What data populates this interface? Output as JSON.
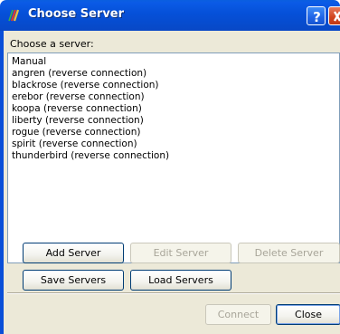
{
  "window": {
    "title": "Choose Server"
  },
  "dialog": {
    "label": "Choose a server:",
    "servers": [
      "Manual",
      "angren (reverse connection)",
      "blackrose (reverse connection)",
      "erebor (reverse connection)",
      "koopa (reverse connection)",
      "liberty (reverse connection)",
      "rogue (reverse connection)",
      "spirit (reverse connection)",
      "thunderbird (reverse connection)"
    ]
  },
  "buttons": {
    "add_server": "Add Server",
    "edit_server": "Edit Server",
    "delete_server": "Delete Server",
    "save_servers": "Save Servers",
    "load_servers": "Load Servers",
    "connect": "Connect",
    "close": "Close"
  },
  "colors": {
    "titlebar": "#0550d8",
    "dialog_bg": "#ece9d8",
    "close_button": "#d0431c"
  }
}
